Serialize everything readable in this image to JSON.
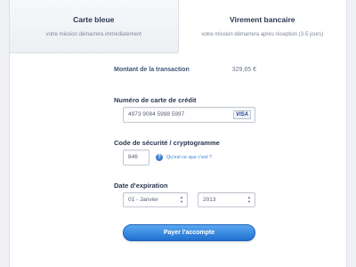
{
  "tabs": [
    {
      "title": "Carte bleue",
      "subtitle": "votre mission démarrera immédiatement"
    },
    {
      "title": "Virement bancaire",
      "subtitle": "votre mission démarrera après réception (3-5 jours)"
    }
  ],
  "amount": {
    "label": "Montant de la transaction",
    "value": "329,65 €"
  },
  "card": {
    "label": "Numéro de carte de crédit",
    "value": "4973 9084 5998 5997",
    "brand": "VISA"
  },
  "security": {
    "label": "Code de sécurité / cryptogramme",
    "value": "846",
    "help_icon": "?",
    "help_text": "Qu'est ce que c'est ?"
  },
  "expiry": {
    "label": "Date d'expiration",
    "month": "01 - Janvier",
    "year": "2013"
  },
  "submit_label": "Payer l'accompte",
  "colors": {
    "accent": "#3f7fd0",
    "button": "#1f6fd0",
    "text": "#2a3550"
  }
}
